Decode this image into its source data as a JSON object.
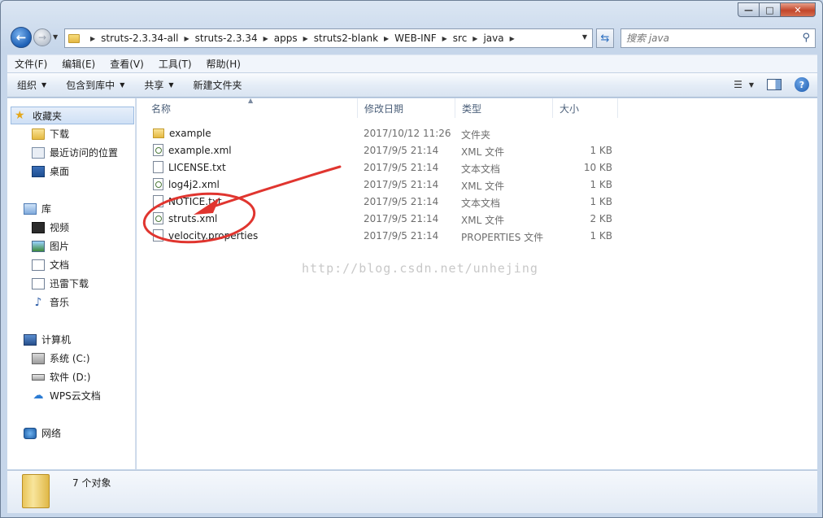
{
  "address_bar": {
    "breadcrumbs": [
      "struts-2.3.34-all",
      "struts-2.3.34",
      "apps",
      "struts2-blank",
      "WEB-INF",
      "src",
      "java"
    ]
  },
  "search": {
    "placeholder": "搜索 java"
  },
  "menu": [
    "文件(F)",
    "编辑(E)",
    "查看(V)",
    "工具(T)",
    "帮助(H)"
  ],
  "toolbar": {
    "organize": "组织",
    "include_in_library": "包含到库中",
    "share": "共享",
    "new_folder": "新建文件夹"
  },
  "nav_pane": {
    "favorites": {
      "label": "收藏夹",
      "items": [
        "下载",
        "最近访问的位置",
        "桌面"
      ]
    },
    "libraries": {
      "label": "库",
      "items": [
        "视频",
        "图片",
        "文档",
        "迅雷下载",
        "音乐"
      ]
    },
    "computer": {
      "label": "计算机",
      "items": [
        "系统 (C:)",
        "软件 (D:)",
        "WPS云文档"
      ]
    },
    "network": {
      "label": "网络"
    }
  },
  "columns": {
    "name": "名称",
    "date": "修改日期",
    "type": "类型",
    "size": "大小"
  },
  "files": [
    {
      "name": "example",
      "date": "2017/10/12 11:26",
      "type": "文件夹",
      "size": "",
      "icon": "folder-icon"
    },
    {
      "name": "example.xml",
      "date": "2017/9/5 21:14",
      "type": "XML 文件",
      "size": "1 KB",
      "icon": "xml-file-icon"
    },
    {
      "name": "LICENSE.txt",
      "date": "2017/9/5 21:14",
      "type": "文本文档",
      "size": "10 KB",
      "icon": "text-file-icon"
    },
    {
      "name": "log4j2.xml",
      "date": "2017/9/5 21:14",
      "type": "XML 文件",
      "size": "1 KB",
      "icon": "xml-file-icon"
    },
    {
      "name": "NOTICE.txt",
      "date": "2017/9/5 21:14",
      "type": "文本文档",
      "size": "1 KB",
      "icon": "text-file-icon"
    },
    {
      "name": "struts.xml",
      "date": "2017/9/5 21:14",
      "type": "XML 文件",
      "size": "2 KB",
      "icon": "xml-file-icon"
    },
    {
      "name": "velocity.properties",
      "date": "2017/9/5 21:14",
      "type": "PROPERTIES 文件",
      "size": "1 KB",
      "icon": "properties-file-icon"
    }
  ],
  "watermark": "http://blog.csdn.net/unhejing",
  "status": {
    "item_count": "7 个对象"
  },
  "annotation_color": "#e0352f"
}
